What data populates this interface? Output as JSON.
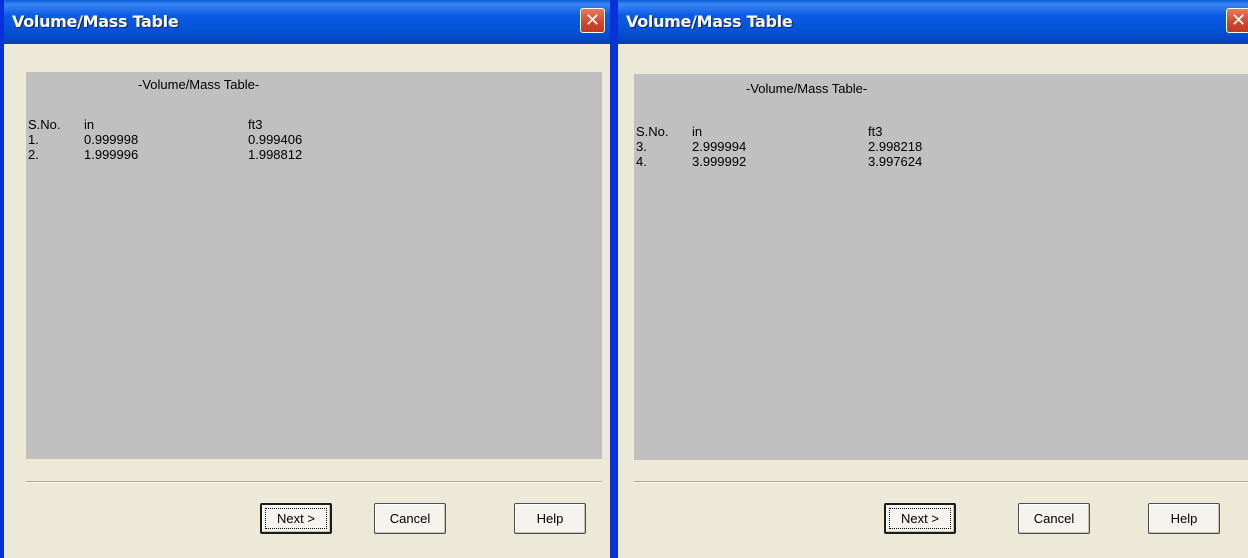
{
  "windows": [
    {
      "title": "Volume/Mass Table",
      "close_glyph": "✕",
      "panel_title": "-Volume/Mass Table-",
      "table": {
        "columns": [
          "S.No.",
          "in",
          "ft3"
        ],
        "rows": [
          [
            "1.",
            "0.999998",
            "0.999406"
          ],
          [
            "2.",
            "1.999996",
            "1.998812"
          ]
        ]
      },
      "buttons": {
        "next": "Next >",
        "cancel": "Cancel",
        "help": "Help"
      }
    },
    {
      "title": "Volume/Mass Table",
      "close_glyph": "✕",
      "panel_title": "-Volume/Mass Table-",
      "table": {
        "columns": [
          "S.No.",
          "in",
          "ft3"
        ],
        "rows": [
          [
            "3.",
            "2.999994",
            "2.998218"
          ],
          [
            "4.",
            "3.999992",
            "3.997624"
          ]
        ]
      },
      "buttons": {
        "next": "Next >",
        "cancel": "Cancel",
        "help": "Help"
      }
    }
  ],
  "colors": {
    "titlebar": "#0a5ae6",
    "window_body": "#ece9d8",
    "panel": "#c0c0c0",
    "close_button": "#d0452b"
  }
}
